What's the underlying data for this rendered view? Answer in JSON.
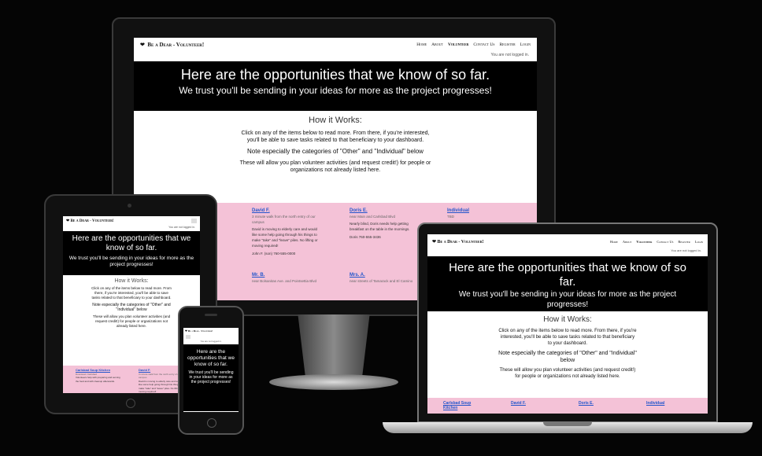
{
  "site": {
    "brand": "Be a Dear - Volunteer!",
    "nav": [
      "Home",
      "About",
      "Volunteer",
      "Contact Us",
      "Register",
      "Login"
    ],
    "status": "You are not logged in."
  },
  "hero": {
    "title": "Here are the opportunities that we know of so far.",
    "subtitle": "We trust you'll be sending in your ideas for more as the project progresses!"
  },
  "how": {
    "heading": "How it Works:",
    "p1": "Click on any of the items below to read more. From there, if you're interested, you'll be able to save tasks related to that beneficiary to your dashboard.",
    "p2": "Note especially the categories of \"Other\" and \"Individual\" below",
    "p3": "These will allow you plan volunteer activities (and request credit!) for people or organizations not already listed here."
  },
  "cards": [
    {
      "name": "David F.",
      "sub": "3 minute walk from the north entry of our campus",
      "body": "David is moving to elderly care and would like some help going through his things to make \"take\" and \"leave\" piles. No lifting or moving required!",
      "contact": "John F. (son) 760-555-0000"
    },
    {
      "name": "Doris E.",
      "sub": "near Main and Carlsbad Blvd",
      "body": "Nearly blind, Doris needs help getting breakfast on the table in the mornings.",
      "contact": "Doris 760-555-3436"
    },
    {
      "name": "Individual",
      "sub": "TBD"
    },
    {
      "name": "Mr. B.",
      "sub": "near Bolsanitas Ave. and Pointsettia Blvd"
    },
    {
      "name": "Mrs. A.",
      "sub": "near streets of Tamarack and El Camino"
    },
    {
      "name": "Carlsbad Soup Kitchen",
      "sub": "Downtown Carlsbad",
      "body": "Volunteers help with preparing and serving the food and with cleanup afterwards."
    }
  ],
  "laptop_cards": [
    "Carlsbad Soup Kitchen",
    "David F.",
    "Doris E.",
    "Individual"
  ],
  "colors": {
    "bg": "#050505",
    "hero": "#000000",
    "cards": "#f4c2d7",
    "link": "#2255cc"
  }
}
